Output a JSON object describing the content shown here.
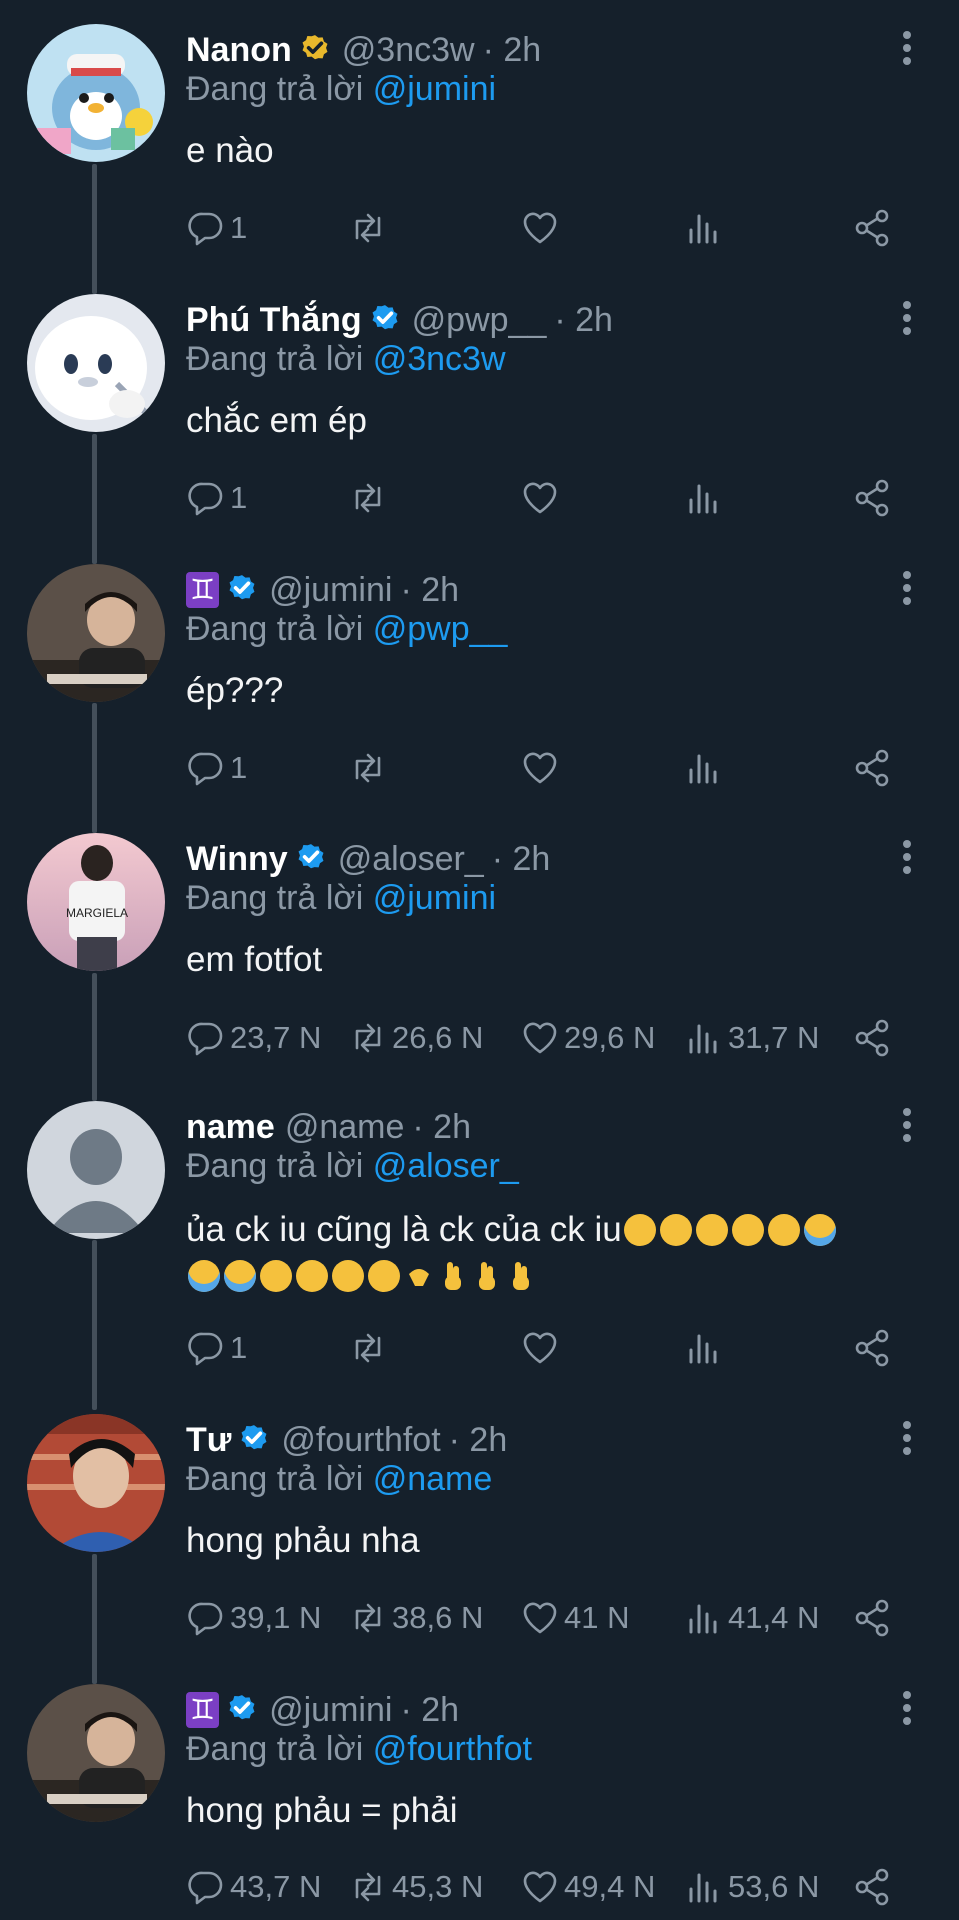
{
  "reply_prefix": "Đang trả lời",
  "tweets": [
    {
      "name": "Nanon",
      "badge": "gold-check-icon",
      "handle": "@3nc3w",
      "time": "· 2h",
      "reply_to": "@jumini",
      "text": "e nào",
      "stats": {
        "reply": "1",
        "retweet": "",
        "like": "",
        "view": ""
      }
    },
    {
      "name": "Phú Thắng",
      "badge": "blue-check-icon",
      "handle": "@pwp__",
      "time": "· 2h",
      "reply_to": "@3nc3w",
      "text": "chắc em ép",
      "stats": {
        "reply": "1",
        "retweet": "",
        "like": "",
        "view": ""
      }
    },
    {
      "name": "♊",
      "badge": "blue-check-icon",
      "handle": "@jumini",
      "time": "· 2h",
      "reply_to": "@pwp__",
      "text": "ép???",
      "stats": {
        "reply": "1",
        "retweet": "",
        "like": "",
        "view": ""
      }
    },
    {
      "name": "Winny",
      "badge": "blue-check-icon",
      "handle": "@aloser_",
      "time": "· 2h",
      "reply_to": "@jumini",
      "text": "em fotfot",
      "stats": {
        "reply": "23,7 N",
        "retweet": "26,6 N",
        "like": "29,6 N",
        "view": "31,7 N"
      }
    },
    {
      "name": "name",
      "badge": "",
      "handle": "@name",
      "time": "· 2h",
      "reply_to": "@aloser_",
      "text": "ủa ck iu cũng là ck của ck iu",
      "stats": {
        "reply": "1",
        "retweet": "",
        "like": "",
        "view": ""
      }
    },
    {
      "name": "Tư",
      "badge": "blue-check-icon",
      "handle": "@fourthfot",
      "time": "· 2h",
      "reply_to": "@name",
      "text": "hong phảu nha",
      "stats": {
        "reply": "39,1 N",
        "retweet": "38,6 N",
        "like": "41 N",
        "view": "41,4 N"
      }
    },
    {
      "name": "♊",
      "badge": "blue-check-icon",
      "handle": "@jumini",
      "time": "· 2h",
      "reply_to": "@fourthfot",
      "text": "hong phảu = phải",
      "stats": {
        "reply": "43,7 N",
        "retweet": "45,3 N",
        "like": "49,4 N",
        "view": "53,6 N"
      }
    }
  ],
  "colors": {
    "background": "#15202b",
    "accent": "#1d9bf0",
    "muted": "#8b98a5",
    "thread": "#444f5a",
    "gold": "#e8b82c"
  }
}
